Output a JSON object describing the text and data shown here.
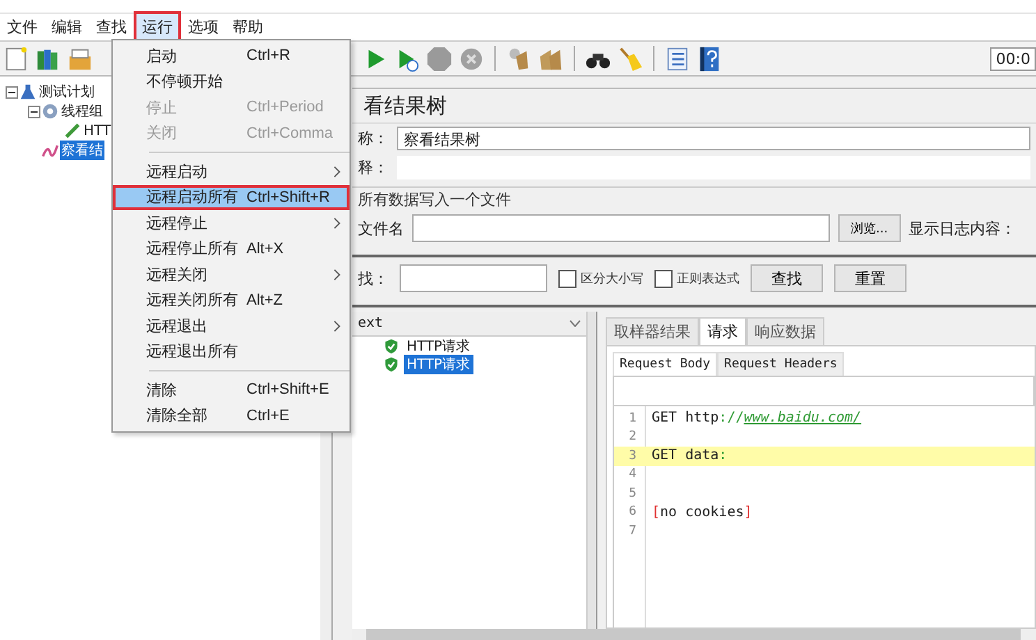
{
  "menubar": [
    {
      "label": "文件",
      "selected": false
    },
    {
      "label": "编辑",
      "selected": false
    },
    {
      "label": "查找",
      "selected": false
    },
    {
      "label": "运行",
      "selected": true
    },
    {
      "label": "选项",
      "selected": false
    },
    {
      "label": "帮助",
      "selected": false
    }
  ],
  "toolbar": {
    "time": "00:0"
  },
  "tree": [
    {
      "label": "测试计划",
      "kind": "test-plan",
      "selected": false,
      "expanded": true,
      "children": [
        {
          "label": "线程组",
          "kind": "thread-group",
          "selected": false,
          "expanded": true,
          "children": [
            {
              "label": "HTT",
              "kind": "sampler",
              "selected": false
            }
          ]
        },
        {
          "label": "察看结",
          "kind": "listener",
          "selected": true
        }
      ]
    }
  ],
  "menu": {
    "groups": [
      [
        {
          "label": "启动",
          "shortcut": "Ctrl+R",
          "disabled": false,
          "submenu": false,
          "selected": false
        },
        {
          "label": "不停顿开始",
          "disabled": false,
          "submenu": false,
          "selected": false
        },
        {
          "label": "停止",
          "shortcut": "Ctrl+Period",
          "disabled": true,
          "submenu": false,
          "selected": false
        },
        {
          "label": "关闭",
          "shortcut": "Ctrl+Comma",
          "disabled": true,
          "submenu": false,
          "selected": false
        }
      ],
      [
        {
          "label": "远程启动",
          "disabled": false,
          "submenu": true,
          "selected": false
        },
        {
          "label": "远程启动所有",
          "shortcut": "Ctrl+Shift+R",
          "disabled": false,
          "submenu": false,
          "selected": true
        },
        {
          "label": "远程停止",
          "disabled": false,
          "submenu": true,
          "selected": false
        },
        {
          "label": "远程停止所有",
          "shortcut": "Alt+X",
          "disabled": false,
          "submenu": false,
          "selected": false
        },
        {
          "label": "远程关闭",
          "disabled": false,
          "submenu": true,
          "selected": false
        },
        {
          "label": "远程关闭所有",
          "shortcut": "Alt+Z",
          "disabled": false,
          "submenu": false,
          "selected": false
        },
        {
          "label": "远程退出",
          "disabled": false,
          "submenu": true,
          "selected": false
        },
        {
          "label": "远程退出所有",
          "disabled": false,
          "submenu": false,
          "selected": false
        }
      ],
      [
        {
          "label": "清除",
          "shortcut": "Ctrl+Shift+E",
          "disabled": false,
          "submenu": false,
          "selected": false
        },
        {
          "label": "清除全部",
          "shortcut": "Ctrl+E",
          "disabled": false,
          "submenu": false,
          "selected": false
        }
      ]
    ]
  },
  "panel": {
    "title": "看结果树",
    "name_label": "称：",
    "name_value": "察看结果树",
    "comment_label": "释：",
    "file_section": "所有数据写入一个文件",
    "file_label": "文件名",
    "browse_button": "浏览...",
    "log_label": "显示日志内容：",
    "search_label": "找：",
    "checkboxes": [
      {
        "label": "区分大小写",
        "checked": false
      },
      {
        "label": "正则表达式",
        "checked": false
      }
    ],
    "buttons": [
      "查找",
      "重置"
    ],
    "results": {
      "renderer": "ext",
      "items": [
        {
          "label": "HTTP请求",
          "selected": false
        },
        {
          "label": "HTTP请求",
          "selected": true
        }
      ]
    },
    "tabs": [
      {
        "label": "取样器结果",
        "selected": false
      },
      {
        "label": "请求",
        "selected": true
      },
      {
        "label": "响应数据",
        "selected": false
      }
    ],
    "subtabs": [
      {
        "label": "Request Body",
        "selected": true
      },
      {
        "label": "Request Headers",
        "selected": false
      }
    ],
    "code": [
      {
        "number": "1",
        "highlighted": false,
        "segments": [
          {
            "kind": "plain",
            "text": "GET http"
          },
          {
            "kind": "punct",
            "text": "://"
          },
          {
            "kind": "link",
            "text": "www.baidu.com/"
          }
        ]
      },
      {
        "number": "2",
        "highlighted": false
      },
      {
        "number": "3",
        "highlighted": true,
        "segments": [
          {
            "kind": "plain",
            "text": "GET data"
          },
          {
            "kind": "punct",
            "text": ":"
          }
        ]
      },
      {
        "number": "4",
        "highlighted": false
      },
      {
        "number": "5",
        "highlighted": false
      },
      {
        "number": "6",
        "highlighted": false,
        "segments": [
          {
            "kind": "bracket",
            "text": "["
          },
          {
            "kind": "plain",
            "text": "no cookies"
          },
          {
            "kind": "bracket",
            "text": "]"
          }
        ]
      },
      {
        "number": "7",
        "highlighted": false
      }
    ]
  }
}
